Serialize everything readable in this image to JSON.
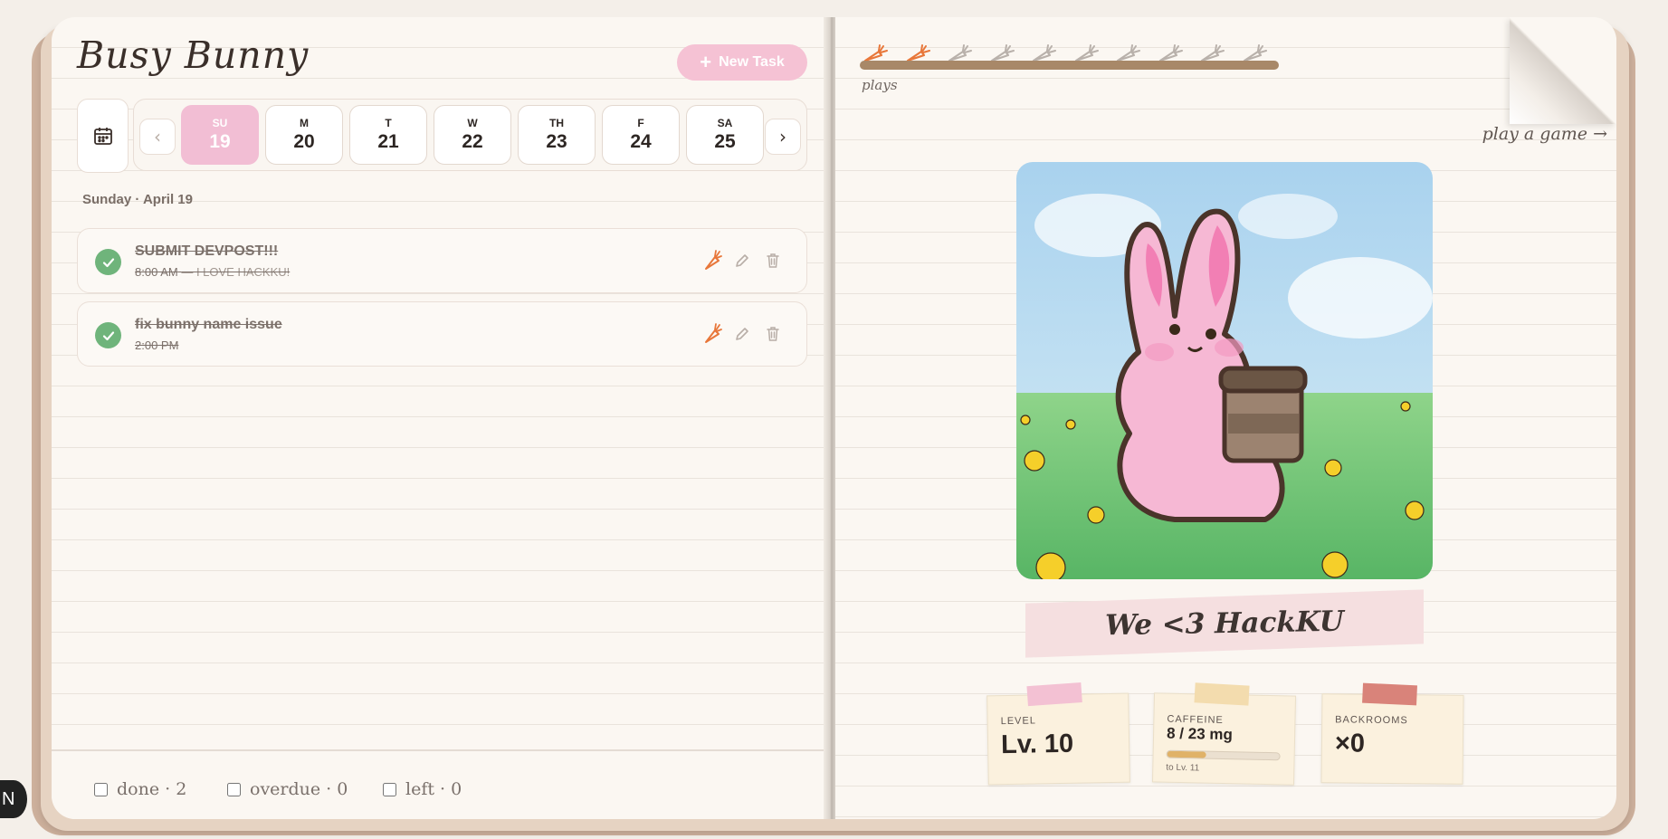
{
  "app": {
    "title": "Busy Bunny"
  },
  "toolbar": {
    "new_task_label": "New Task"
  },
  "week": {
    "days": [
      {
        "dow": "SU",
        "num": "19",
        "active": true
      },
      {
        "dow": "M",
        "num": "20",
        "active": false
      },
      {
        "dow": "T",
        "num": "21",
        "active": false
      },
      {
        "dow": "W",
        "num": "22",
        "active": false
      },
      {
        "dow": "TH",
        "num": "23",
        "active": false
      },
      {
        "dow": "F",
        "num": "24",
        "active": false
      },
      {
        "dow": "SA",
        "num": "25",
        "active": false
      }
    ]
  },
  "date_heading": "Sunday · April 19",
  "tasks": [
    {
      "title": "SUBMIT DEVPOST!!!",
      "time": "8:00 AM",
      "note": "— I LOVE HACKKU!",
      "done": true
    },
    {
      "title": "fix bunny name issue",
      "time": "2:00 PM",
      "note": "",
      "done": true
    }
  ],
  "filters": [
    {
      "label": "done · 2",
      "checked": false
    },
    {
      "label": "overdue · 0",
      "checked": false
    },
    {
      "label": "left · 0",
      "checked": false
    }
  ],
  "corner_badge": "N",
  "plays": {
    "label": "plays",
    "total": 10,
    "earned": 2,
    "colors": {
      "earned": "#e8773a",
      "empty": "#b9b1ab"
    }
  },
  "play_game_link": "play a game →",
  "banner": "We <3 HackKU",
  "stats": {
    "level": {
      "label": "LEVEL",
      "value": "Lv. 10",
      "tape": "#f3c1d3"
    },
    "caffeine": {
      "label": "CAFFEINE",
      "value": "8 / 23 mg",
      "progress": 0.35,
      "sub": "to Lv. 11",
      "tape": "#f3dcae"
    },
    "backrooms": {
      "label": "BACKROOMS",
      "value": "×0",
      "tape": "#d9837a"
    }
  },
  "colors": {
    "accent_pink": "#f2bed4",
    "check_green": "#6fb47b",
    "carrot_orange": "#e8773a"
  }
}
